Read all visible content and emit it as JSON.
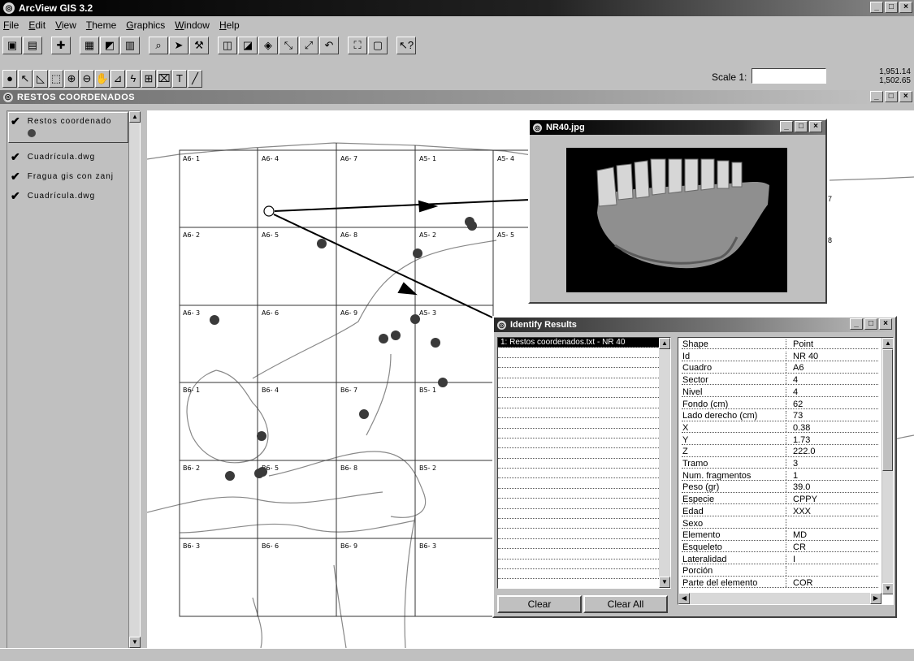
{
  "app": {
    "title": "ArcView GIS 3.2"
  },
  "menu": [
    "File",
    "Edit",
    "View",
    "Theme",
    "Graphics",
    "Window",
    "Help"
  ],
  "menu_underline": [
    "F",
    "E",
    "V",
    "T",
    "G",
    "W",
    "H"
  ],
  "scale": {
    "label": "Scale 1:",
    "value": ""
  },
  "coords": {
    "x": "1,951.14",
    "y": "1,502.65"
  },
  "view": {
    "title": "RESTOS COORDENADOS"
  },
  "toc": [
    {
      "label": "Restos coordenado",
      "checked": true
    },
    {
      "label": "Cuadrícula.dwg",
      "checked": true
    },
    {
      "label": "Fragua gis con zanj",
      "checked": true
    },
    {
      "label": "Cuadrícula.dwg",
      "checked": true
    }
  ],
  "grid_labels": [
    [
      "A6- 1",
      "A6- 4",
      "A6- 7",
      "A5- 1",
      "A5- 4"
    ],
    [
      "A6- 2",
      "A6- 5",
      "A6- 8",
      "A5- 2",
      "A5- 5"
    ],
    [
      "A6- 3",
      "A6- 6",
      "A6- 9",
      "A5- 3",
      ""
    ],
    [
      "B6- 1",
      "B6- 4",
      "B6- 7",
      "B5- 1",
      ""
    ],
    [
      "B6- 2",
      "B6- 5",
      "B6- 8",
      "B5- 2",
      ""
    ],
    [
      "B6- 3",
      "B6- 6",
      "B6- 9",
      "B6- 3",
      ""
    ]
  ],
  "partial_labels": [
    "7",
    "8"
  ],
  "image_window": {
    "title": "NR40.jpg"
  },
  "identify": {
    "title": "Identify Results",
    "list": [
      "1:  Restos coordenados.txt - NR 40"
    ],
    "clear": "Clear",
    "clear_all": "Clear All",
    "attributes": [
      {
        "name": "Shape",
        "value": "Point"
      },
      {
        "name": "Id",
        "value": "NR 40"
      },
      {
        "name": "Cuadro",
        "value": "A6"
      },
      {
        "name": "Sector",
        "value": "4"
      },
      {
        "name": "Nivel",
        "value": "4"
      },
      {
        "name": "Fondo (cm)",
        "value": "62"
      },
      {
        "name": "Lado derecho (cm)",
        "value": "73"
      },
      {
        "name": "X",
        "value": "0.38"
      },
      {
        "name": "Y",
        "value": "1.73"
      },
      {
        "name": "Z",
        "value": "222.0"
      },
      {
        "name": "Tramo",
        "value": "3"
      },
      {
        "name": "Num. fragmentos",
        "value": "1"
      },
      {
        "name": "Peso (gr)",
        "value": "39.0"
      },
      {
        "name": "Especie",
        "value": "CPPY"
      },
      {
        "name": "Edad",
        "value": "XXX"
      },
      {
        "name": "Sexo",
        "value": ""
      },
      {
        "name": "Elemento",
        "value": "MD"
      },
      {
        "name": "Esqueleto",
        "value": "CR"
      },
      {
        "name": "Lateralidad",
        "value": "I"
      },
      {
        "name": "Porción",
        "value": ""
      },
      {
        "name": "Parte del elemento",
        "value": "COR"
      }
    ]
  }
}
